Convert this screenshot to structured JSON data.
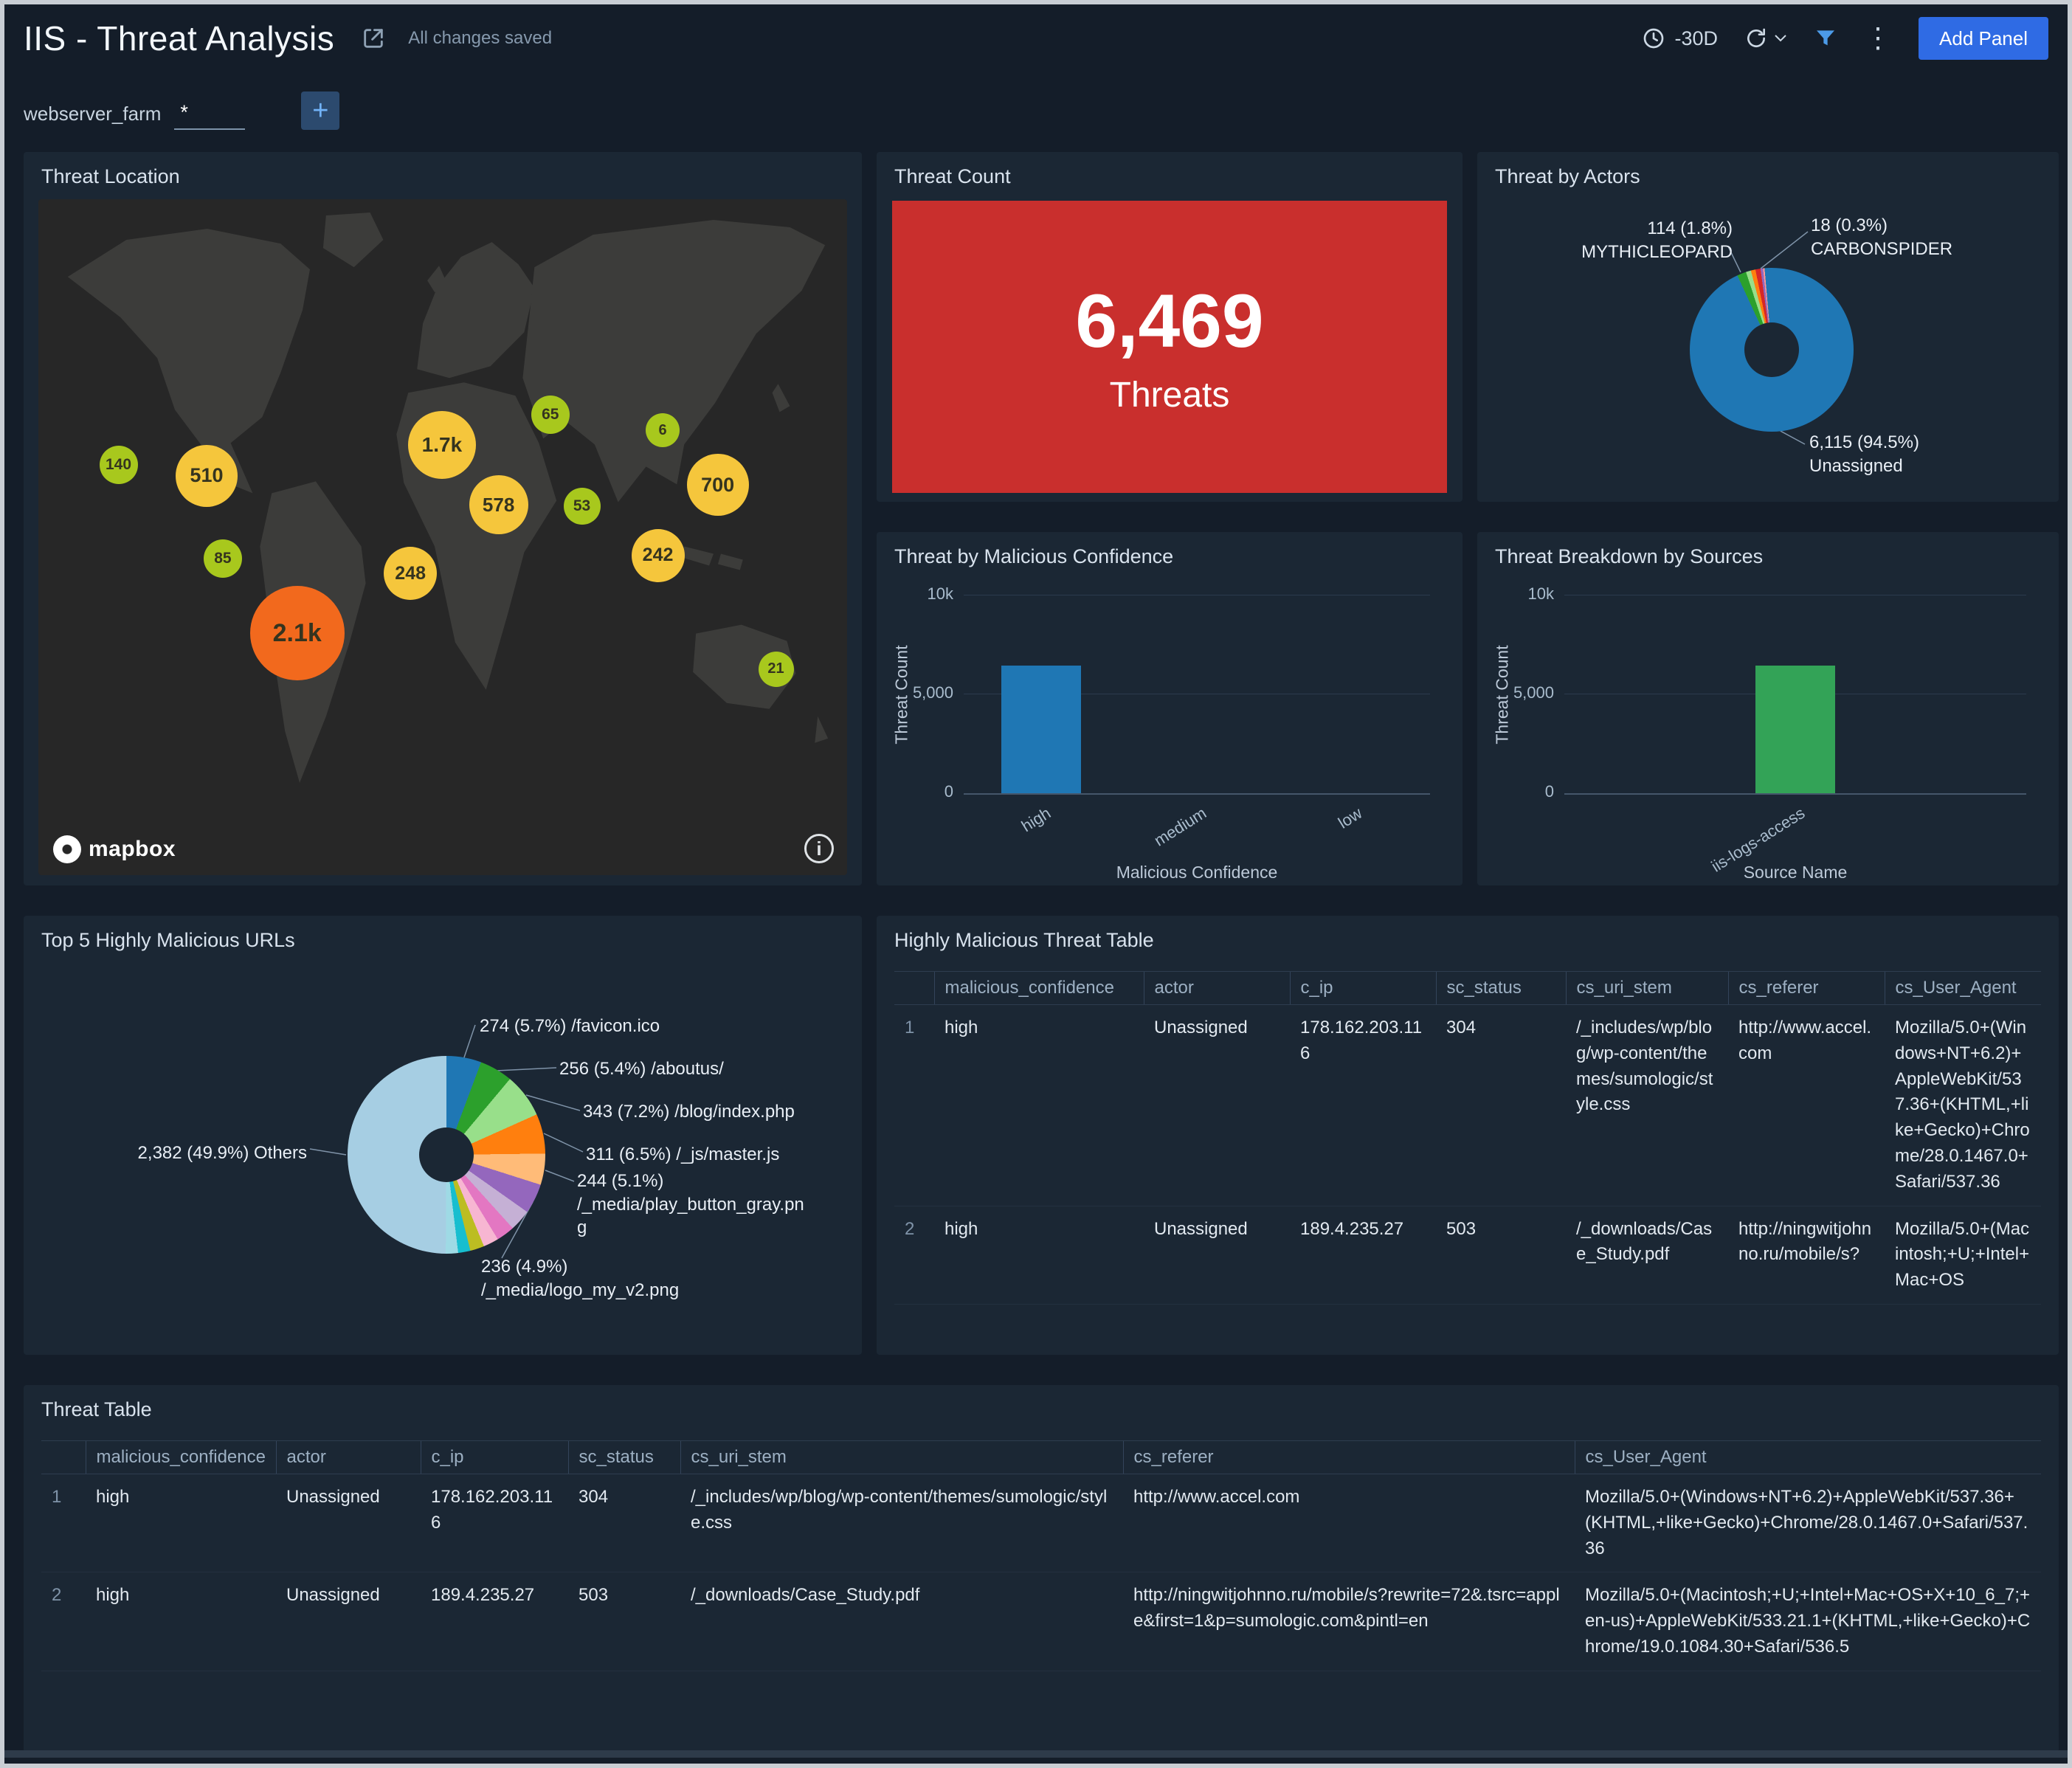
{
  "header": {
    "title": "IIS - Threat Analysis",
    "saved_status": "All changes saved",
    "time_range": "-30D",
    "add_panel_label": "Add Panel",
    "accent_color": "#2f6be4"
  },
  "filter": {
    "name": "webserver_farm",
    "value": "*",
    "add_button": "+"
  },
  "panels": {
    "threat_location": {
      "title": "Threat Location",
      "attribution": "mapbox",
      "bubbles": [
        {
          "value": "140",
          "color": "#a8c81d",
          "x": 9.9,
          "y": 39.3,
          "r": 26
        },
        {
          "value": "510",
          "color": "#f5c63c",
          "x": 20.8,
          "y": 40.9,
          "r": 42
        },
        {
          "value": "85",
          "color": "#a8c81d",
          "x": 22.8,
          "y": 53.2,
          "r": 26
        },
        {
          "value": "2.1k",
          "color": "#f2691d",
          "x": 32.0,
          "y": 64.2,
          "r": 64
        },
        {
          "value": "248",
          "color": "#f5c63c",
          "x": 46.0,
          "y": 55.4,
          "r": 36
        },
        {
          "value": "1.7k",
          "color": "#f5c63c",
          "x": 49.9,
          "y": 36.4,
          "r": 46
        },
        {
          "value": "578",
          "color": "#f5c63c",
          "x": 56.9,
          "y": 45.2,
          "r": 40
        },
        {
          "value": "65",
          "color": "#a8c81d",
          "x": 63.3,
          "y": 31.9,
          "r": 26
        },
        {
          "value": "53",
          "color": "#a8c81d",
          "x": 67.2,
          "y": 45.4,
          "r": 25
        },
        {
          "value": "6",
          "color": "#a8c81d",
          "x": 77.2,
          "y": 34.2,
          "r": 23
        },
        {
          "value": "700",
          "color": "#f5c63c",
          "x": 84.0,
          "y": 42.3,
          "r": 42
        },
        {
          "value": "242",
          "color": "#f5c63c",
          "x": 76.6,
          "y": 52.7,
          "r": 36
        },
        {
          "value": "21",
          "color": "#a8c81d",
          "x": 91.2,
          "y": 69.5,
          "r": 24
        }
      ]
    },
    "threat_count": {
      "title": "Threat Count",
      "value": "6,469",
      "label": "Threats",
      "color": "#c92f2d"
    },
    "threat_actors": {
      "title": "Threat by Actors"
    },
    "malicious_confidence": {
      "title": "Threat by Malicious Confidence"
    },
    "sources": {
      "title": "Threat Breakdown by Sources"
    },
    "top_urls": {
      "title": "Top 5 Highly Malicious URLs"
    },
    "hm_table": {
      "title": "Highly Malicious Threat Table"
    },
    "threat_table": {
      "title": "Threat Table"
    }
  },
  "chart_data": [
    {
      "id": "actors",
      "type": "pie",
      "title": "Threat by Actors",
      "hole": 0.34,
      "start_angle": 355,
      "slices": [
        {
          "name": "Unassigned",
          "value": 6115,
          "pct": 94.5,
          "color": "#1f77b4",
          "label": "6,115 (94.5%)\nUnassigned"
        },
        {
          "name": "MYTHICLEOPARD",
          "value": 114,
          "pct": 1.8,
          "color": "#2ca02c",
          "label": "114 (1.8%)\nMYTHICLEOPARD"
        },
        {
          "name": "other-1",
          "pct": 1.0,
          "color": "#98df8a"
        },
        {
          "name": "other-2",
          "pct": 0.9,
          "color": "#ff7f0e"
        },
        {
          "name": "other-3",
          "pct": 1.0,
          "color": "#d62728"
        },
        {
          "name": "other-4",
          "pct": 0.5,
          "color": "#9467bd"
        },
        {
          "name": "CARBONSPIDER",
          "value": 18,
          "pct": 0.3,
          "color": "#ff9896",
          "label": "18 (0.3%)\nCARBONSPIDER"
        }
      ]
    },
    {
      "id": "confidence",
      "type": "bar",
      "title": "Threat by Malicious Confidence",
      "categories": [
        "high",
        "medium",
        "low"
      ],
      "values": [
        6469,
        0,
        0
      ],
      "bar_color": "#1f77b4",
      "xlabel": "Malicious Confidence",
      "ylabel": "Threat Count",
      "ylim": [
        0,
        10000
      ],
      "yticks": [
        {
          "v": 0,
          "label": "0"
        },
        {
          "v": 5000,
          "label": "5,000"
        },
        {
          "v": 10000,
          "label": "10k"
        }
      ]
    },
    {
      "id": "sources",
      "type": "bar",
      "title": "Threat Breakdown by Sources",
      "categories": [
        "iis-logs-access"
      ],
      "values": [
        6469
      ],
      "bar_color": "#33a357",
      "xlabel": "Source Name",
      "ylabel": "Threat Count",
      "ylim": [
        0,
        10000
      ],
      "yticks": [
        {
          "v": 0,
          "label": "0"
        },
        {
          "v": 5000,
          "label": "5,000"
        },
        {
          "v": 10000,
          "label": "10k"
        }
      ]
    },
    {
      "id": "urls",
      "type": "pie",
      "title": "Top 5 Highly Malicious URLs",
      "hole": 0.27,
      "start_angle": 0,
      "slices": [
        {
          "name": "/favicon.ico",
          "value": 274,
          "pct": 5.7,
          "color": "#1f77b4",
          "label": "274 (5.7%) /favicon.ico"
        },
        {
          "name": "/aboutus/",
          "value": 256,
          "pct": 5.4,
          "color": "#2ca02c",
          "label": "256 (5.4%) /aboutus/"
        },
        {
          "name": "/blog/index.php",
          "value": 343,
          "pct": 7.2,
          "color": "#98df8a",
          "label": "343 (7.2%) /blog/index.php"
        },
        {
          "name": "/_js/master.js",
          "value": 311,
          "pct": 6.5,
          "color": "#ff7f0e",
          "label": "311 (6.5%) /_js/master.js"
        },
        {
          "name": "/_media/play_button_gray.png",
          "value": 244,
          "pct": 5.1,
          "color": "#ffbb78",
          "label": "244 (5.1%)\n/_media/play_button_gray.png"
        },
        {
          "name": "/_media/logo_my_v2.png",
          "value": 236,
          "pct": 4.9,
          "color": "#9467bd",
          "label": "236 (4.9%)\n/_media/logo_my_v2.png"
        },
        {
          "name": "other-1",
          "pct": 3.5,
          "color": "#c5b0d5"
        },
        {
          "name": "other-2",
          "pct": 3.0,
          "color": "#e377c2"
        },
        {
          "name": "other-3",
          "pct": 2.5,
          "color": "#f7b6d2"
        },
        {
          "name": "other-4",
          "pct": 2.3,
          "color": "#bcbd22"
        },
        {
          "name": "other-5",
          "pct": 2.0,
          "color": "#17becf"
        },
        {
          "name": "other-6",
          "pct": 2.0,
          "color": "#9edae5"
        },
        {
          "name": "Others",
          "value": 2382,
          "pct": 49.9,
          "color": "#a6cee3",
          "label": "2,382 (49.9%) Others"
        }
      ]
    }
  ],
  "tables": {
    "hm": {
      "columns": [
        "malicious_confidence",
        "actor",
        "c_ip",
        "sc_status",
        "cs_uri_stem",
        "cs_referer",
        "cs_User_Agent"
      ],
      "rows": [
        {
          "idx": "1",
          "cells": [
            "high",
            "Unassigned",
            "178.162.203.116",
            "304",
            "/_includes/wp/blog/wp-content/themes/sumologic/style.css",
            "http://www.accel.com",
            "Mozilla/5.0+(Windows+NT+6.2)+AppleWebKit/537.36+(KHTML,+like+Gecko)+Chrome/28.0.1467.0+Safari/537.36"
          ]
        },
        {
          "idx": "2",
          "cells": [
            "high",
            "Unassigned",
            "189.4.235.27",
            "503",
            "/_downloads/Case_Study.pdf",
            "http://ningwitjohnno.ru/mobile/s?",
            "Mozilla/5.0+(Macintosh;+U;+Intel+Mac+OS"
          ]
        }
      ]
    },
    "threat": {
      "columns": [
        "malicious_confidence",
        "actor",
        "c_ip",
        "sc_status",
        "cs_uri_stem",
        "cs_referer",
        "cs_User_Agent"
      ],
      "rows": [
        {
          "idx": "1",
          "cells": [
            "high",
            "Unassigned",
            "178.162.203.116",
            "304",
            "/_includes/wp/blog/wp-content/themes/sumologic/style.css",
            "http://www.accel.com",
            "Mozilla/5.0+(Windows+NT+6.2)+AppleWebKit/537.36+(KHTML,+like+Gecko)+Chrome/28.0.1467.0+Safari/537.36"
          ]
        },
        {
          "idx": "2",
          "cells": [
            "high",
            "Unassigned",
            "189.4.235.27",
            "503",
            "/_downloads/Case_Study.pdf",
            "http://ningwitjohnno.ru/mobile/s?rewrite=72&.tsrc=apple&first=1&p=sumologic.com&pintl=en",
            "Mozilla/5.0+(Macintosh;+U;+Intel+Mac+OS+X+10_6_7;+en-us)+AppleWebKit/533.21.1+(KHTML,+like+Gecko)+Chrome/19.0.1084.30+Safari/536.5"
          ]
        }
      ]
    }
  }
}
